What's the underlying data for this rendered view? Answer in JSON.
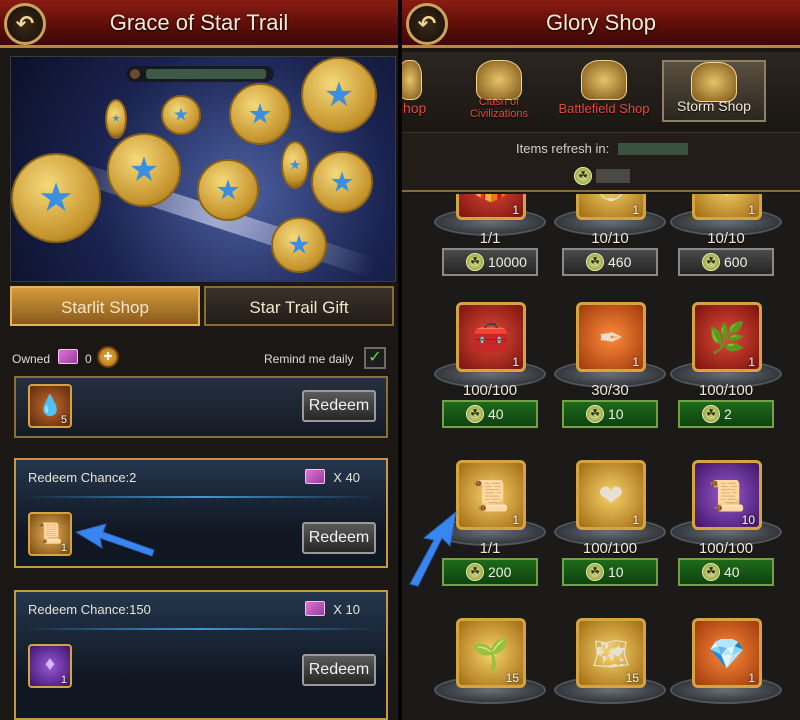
{
  "left": {
    "title": "Grace of Star Trail",
    "tabs": [
      "Starlit Shop",
      "Star Trail Gift"
    ],
    "owned_label": "Owned",
    "owned_count": "0",
    "remind_label": "Remind me daily",
    "remind_checked": true,
    "redeem_label": "Redeem",
    "cards": [
      {
        "chance": "",
        "cost": "",
        "item_qty": "5",
        "item": "drop-icon"
      },
      {
        "chance": "Redeem Chance:2",
        "cost": "X 40",
        "item_qty": "1",
        "item": "scroll-icon"
      },
      {
        "chance": "Redeem Chance:150",
        "cost": "X 10",
        "item_qty": "1",
        "item": "crystal-icon"
      }
    ]
  },
  "right": {
    "title": "Glory Shop",
    "shop_tabs": [
      "Shop",
      "Clash of Civilizations",
      "Battlefield Shop",
      "Storm Shop"
    ],
    "active_tab": "Storm Shop",
    "refresh_label": "Items refresh in:",
    "items": [
      {
        "qty": "1",
        "stock": "1/1",
        "price": "10000",
        "color": "red",
        "icon": "gift-icon",
        "disabled": true
      },
      {
        "qty": "1",
        "stock": "10/10",
        "price": "460",
        "color": "gold",
        "icon": "helmet-icon",
        "disabled": true
      },
      {
        "qty": "1",
        "stock": "10/10",
        "price": "600",
        "color": "gold",
        "icon": "armor-icon",
        "disabled": true
      },
      {
        "qty": "1",
        "stock": "100/100",
        "price": "40",
        "color": "red",
        "icon": "chest-icon",
        "disabled": false
      },
      {
        "qty": "1",
        "stock": "30/30",
        "price": "10",
        "color": "orange",
        "icon": "quill-icon",
        "disabled": false
      },
      {
        "qty": "1",
        "stock": "100/100",
        "price": "2",
        "color": "red",
        "icon": "branch-icon",
        "disabled": false
      },
      {
        "qty": "1",
        "stock": "1/1",
        "price": "200",
        "color": "gold",
        "icon": "scroll-icon",
        "disabled": false
      },
      {
        "qty": "1",
        "stock": "100/100",
        "price": "10",
        "color": "gold",
        "icon": "heart-icon",
        "disabled": false
      },
      {
        "qty": "10",
        "stock": "100/100",
        "price": "40",
        "color": "purple",
        "icon": "scroll-icon",
        "disabled": false
      },
      {
        "qty": "15",
        "stock": "",
        "price": "",
        "color": "gold",
        "icon": "seed-icon",
        "disabled": false
      },
      {
        "qty": "15",
        "stock": "",
        "price": "",
        "color": "gold",
        "icon": "map-icon",
        "disabled": false
      },
      {
        "qty": "1",
        "stock": "",
        "price": "",
        "color": "orange",
        "icon": "box-icon",
        "disabled": false
      }
    ]
  },
  "colors": {
    "header": "#6a120c",
    "gold": "#d5a440",
    "price_green": "#1d6a1a",
    "arrow": "#3a86f0"
  }
}
